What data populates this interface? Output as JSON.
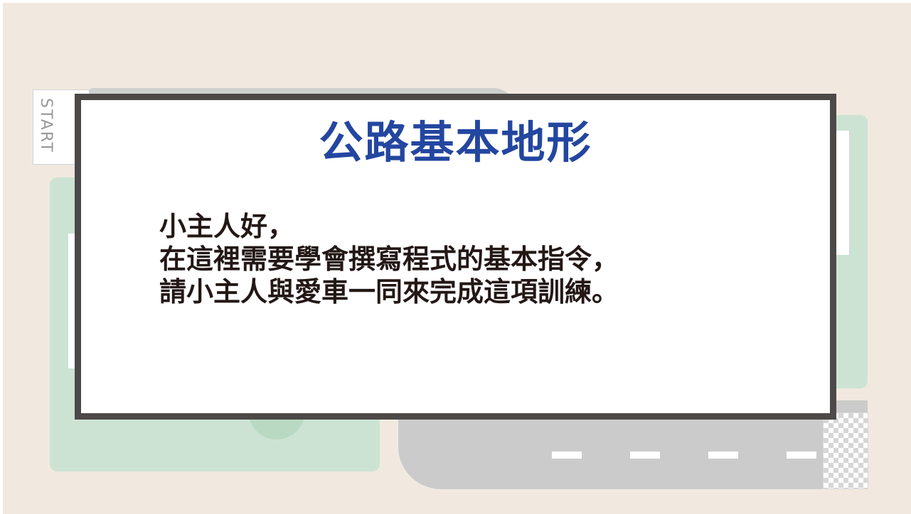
{
  "scene": {
    "start_sign_label": "START",
    "colors": {
      "background": "#f1e9df",
      "grass": "#cce3d4",
      "road": "#cbcbcb",
      "lane_marking": "#ffffff",
      "dialog_border": "#4c4948",
      "title": "#2346a0",
      "body_text": "#231815"
    },
    "icons": [
      "start-sign",
      "finish-flag",
      "bush"
    ]
  },
  "dialog": {
    "title": "公路基本地形",
    "lines": [
      "小主人好，",
      "在這裡需要學會撰寫程式的基本指令，",
      "請小主人與愛車一同來完成這項訓練。"
    ]
  }
}
